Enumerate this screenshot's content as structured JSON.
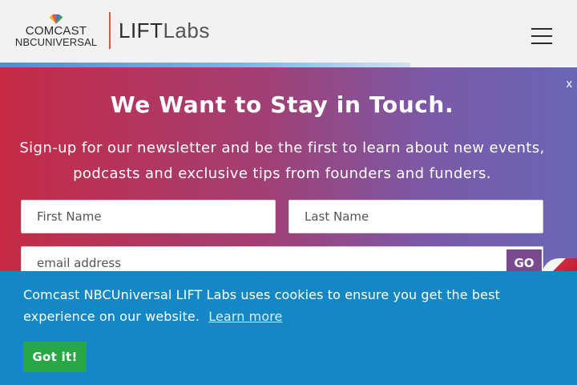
{
  "header": {
    "brand_line1": "COMCAST",
    "brand_line2": "NBCUNIVERSAL",
    "product_bold": "LIFT",
    "product_light": "Labs",
    "menu_icon": "hamburger-icon",
    "colors": {
      "divider": "#e8543a",
      "text": "#2b2b2b"
    }
  },
  "modal": {
    "close_label": "x",
    "title": "We Want to Stay in Touch.",
    "description": "Sign-up for our newsletter and be the first to learn about new events, podcasts and exclusive tips from founders and funders.",
    "first_name_placeholder": "First Name",
    "last_name_placeholder": "Last Name",
    "email_placeholder": "email address",
    "submit_label": "GO",
    "colors": {
      "gradient_start": "#c72a46",
      "gradient_end": "#6a66b6",
      "submit": "#7a4a8c"
    }
  },
  "cookie_banner": {
    "message": "Comcast NBCUniversal LIFT Labs uses cookies to ensure you get the best experience on our website.",
    "learn_more": "Learn more",
    "accept_label": "Got it!",
    "colors": {
      "background": "#1487c4",
      "button": "#27a844"
    }
  }
}
